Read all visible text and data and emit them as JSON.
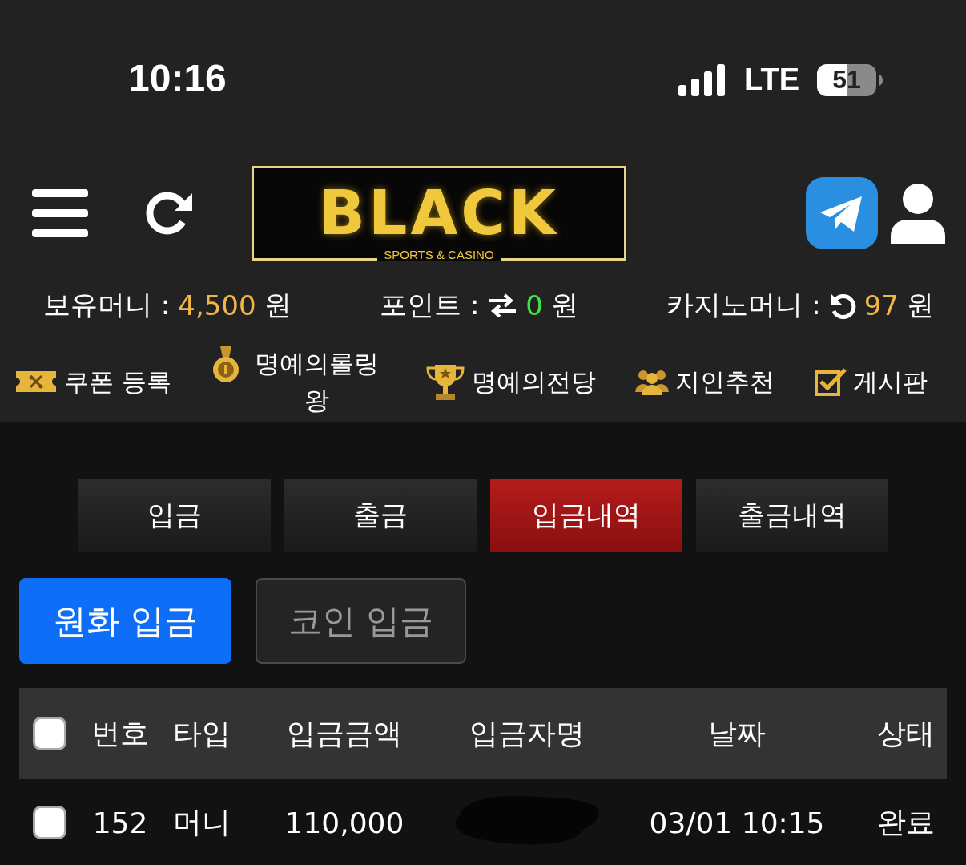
{
  "status_bar": {
    "time": "10:16",
    "network": "LTE",
    "battery": "51"
  },
  "logo": {
    "title": "BLACK",
    "subtitle": "SPORTS & CASINO"
  },
  "balances": [
    {
      "label": "보유머니 :",
      "kind": "plain",
      "amount": "4,500",
      "unit": "원",
      "color": "#f2b646"
    },
    {
      "label": "포인트 :",
      "kind": "exchange",
      "amount": "0",
      "unit": "원",
      "color": "#3fe04a"
    },
    {
      "label": "카지노머니 :",
      "kind": "refresh",
      "amount": "97",
      "unit": "원",
      "color": "#f2b646"
    }
  ],
  "menu": [
    {
      "label": "쿠폰 등록",
      "kind": "ticket"
    },
    {
      "label": "명예의롤링왕",
      "kind": "medal"
    },
    {
      "label": "명예의전당",
      "kind": "trophy"
    },
    {
      "label": "지인추천",
      "kind": "people"
    },
    {
      "label": "게시판",
      "kind": "board"
    }
  ],
  "tabs": [
    {
      "label": "입금",
      "selected": false
    },
    {
      "label": "출금",
      "selected": false
    },
    {
      "label": "입금내역",
      "selected": true
    },
    {
      "label": "출금내역",
      "selected": false
    }
  ],
  "deposit_types": [
    {
      "label": "원화 입금",
      "selected": true
    },
    {
      "label": "코인 입금",
      "selected": false
    }
  ],
  "table": {
    "columns": [
      "번호",
      "타입",
      "입금금액",
      "입금자명",
      "날짜",
      "상태"
    ],
    "header_checked": false,
    "rows": [
      {
        "checked": false,
        "number": "152",
        "type": "머니",
        "amount": "110,000",
        "depositor_redacted": true,
        "date": "03/01 10:15",
        "status": "완료"
      }
    ]
  }
}
